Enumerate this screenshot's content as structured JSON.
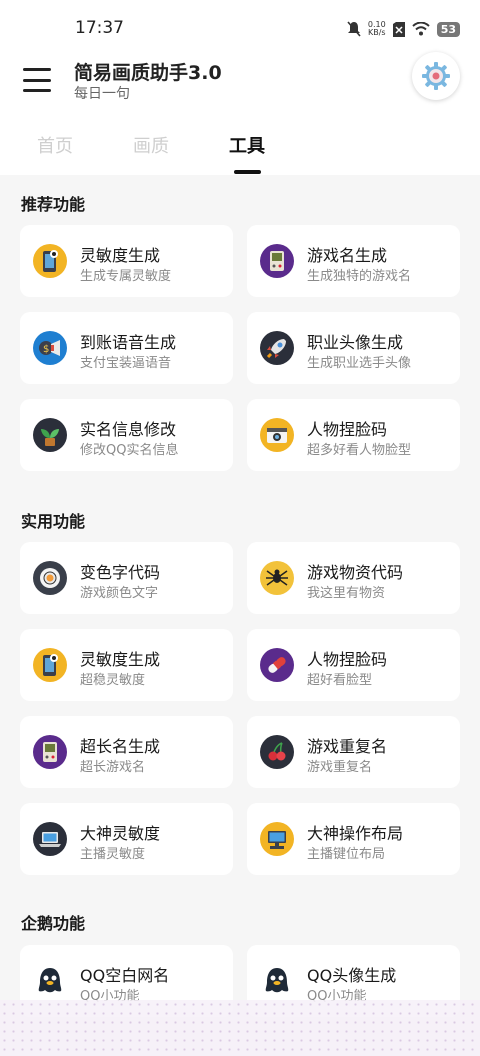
{
  "status_bar": {
    "time": "17:37",
    "speed_value": "0.10",
    "speed_unit": "KB/s",
    "battery": "53"
  },
  "app": {
    "title": "简易画质助手3.0",
    "subtitle": "每日一句"
  },
  "tabs": [
    {
      "label": "首页",
      "active": false
    },
    {
      "label": "画质",
      "active": false
    },
    {
      "label": "工具",
      "active": true
    }
  ],
  "sections": [
    {
      "title": "推荐功能",
      "items": [
        {
          "title": "灵敏度生成",
          "subtitle": "生成专属灵敏度",
          "icon": "phone-icon"
        },
        {
          "title": "游戏名生成",
          "subtitle": "生成独特的游戏名",
          "icon": "gameboy-icon"
        },
        {
          "title": "到账语音生成",
          "subtitle": "支付宝装逼语音",
          "icon": "money-megaphone-icon"
        },
        {
          "title": "职业头像生成",
          "subtitle": "生成职业选手头像",
          "icon": "rocket-icon"
        },
        {
          "title": "实名信息修改",
          "subtitle": "修改QQ实名信息",
          "icon": "plant-icon"
        },
        {
          "title": "人物捏脸码",
          "subtitle": "超多好看人物脸型",
          "icon": "camera-icon"
        }
      ]
    },
    {
      "title": "实用功能",
      "items": [
        {
          "title": "变色字代码",
          "subtitle": "游戏颜色文字",
          "icon": "sushi-icon"
        },
        {
          "title": "游戏物资代码",
          "subtitle": "我这里有物资",
          "icon": "spider-icon"
        },
        {
          "title": "灵敏度生成",
          "subtitle": "超稳灵敏度",
          "icon": "phone-icon"
        },
        {
          "title": "人物捏脸码",
          "subtitle": "超好看脸型",
          "icon": "pill-icon"
        },
        {
          "title": "超长名生成",
          "subtitle": "超长游戏名",
          "icon": "gameboy-icon"
        },
        {
          "title": "游戏重复名",
          "subtitle": "游戏重复名",
          "icon": "cherry-icon"
        },
        {
          "title": "大神灵敏度",
          "subtitle": "主播灵敏度",
          "icon": "laptop-icon"
        },
        {
          "title": "大神操作布局",
          "subtitle": "主播键位布局",
          "icon": "desktop-icon"
        }
      ]
    },
    {
      "title": "企鹅功能",
      "items": [
        {
          "title": "QQ空白网名",
          "subtitle": "QQ小功能",
          "icon": "penguin-icon"
        },
        {
          "title": "QQ头像生成",
          "subtitle": "QQ小功能",
          "icon": "penguin-icon"
        }
      ]
    }
  ]
}
